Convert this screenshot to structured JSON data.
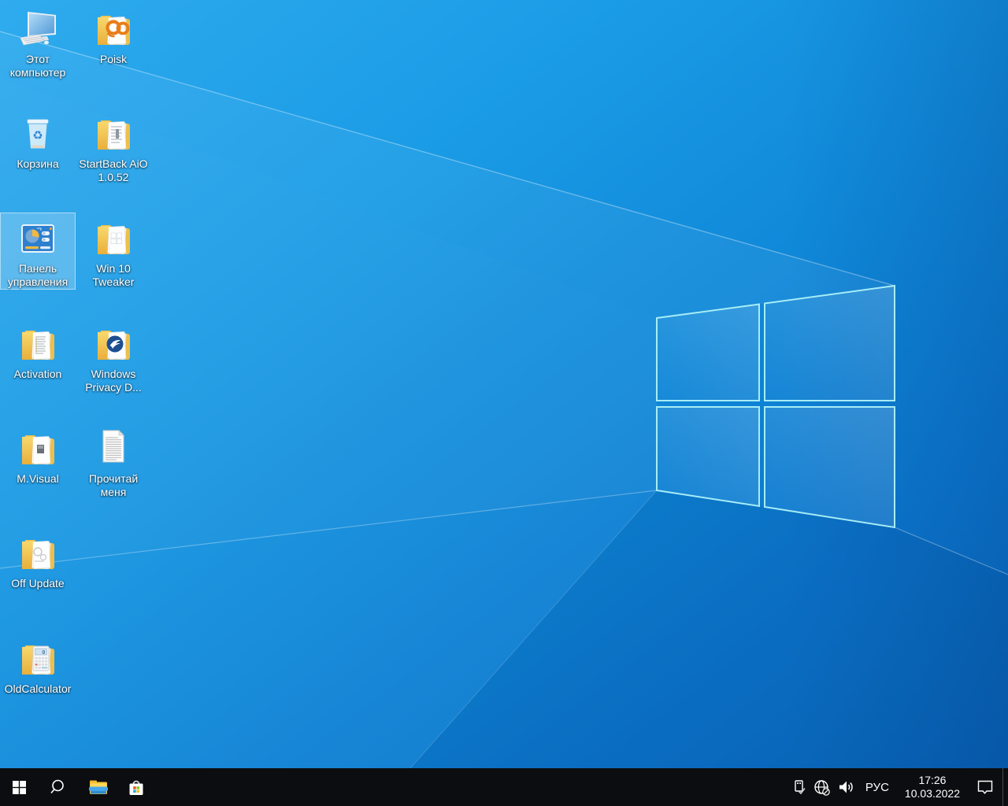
{
  "wallpaper": {
    "base_colors": [
      "#2fabee",
      "#1b9ce6",
      "#1089d9",
      "#0b74cb",
      "#0966bb"
    ],
    "logo_edge_color": "#aef2f8"
  },
  "desktop": {
    "selection_color": "rgba(140,205,244,0.5)",
    "label_color": "#ffffff",
    "icons": [
      {
        "id": "this-pc",
        "label": "Этот\nкомпьютер",
        "selected": false
      },
      {
        "id": "poisk",
        "label": "Poisk",
        "selected": false
      },
      {
        "id": "recycle-bin",
        "label": "Корзина",
        "selected": false
      },
      {
        "id": "startback",
        "label": "StartBack AiO\n1.0.52",
        "selected": false
      },
      {
        "id": "control-panel",
        "label": "Панель\nуправления",
        "selected": true
      },
      {
        "id": "win10-tweaker",
        "label": "Win 10\nTweaker",
        "selected": false
      },
      {
        "id": "activation",
        "label": "Activation",
        "selected": false
      },
      {
        "id": "windows-privacy",
        "label": "Windows\nPrivacy D...",
        "selected": false
      },
      {
        "id": "m-visual",
        "label": "M.Visual",
        "selected": false
      },
      {
        "id": "readme",
        "label": "Прочитай\nменя",
        "selected": false
      },
      {
        "id": "off-update",
        "label": "Off Update",
        "selected": false
      },
      {
        "id": "old-calculator",
        "label": "OldCalculator",
        "selected": false
      }
    ]
  },
  "taskbar": {
    "background": "#0c0d10",
    "buttons": [
      {
        "id": "start"
      },
      {
        "id": "search"
      },
      {
        "id": "file-explorer"
      },
      {
        "id": "microsoft-store"
      }
    ],
    "tray": {
      "icons": [
        {
          "id": "usb-safely-remove"
        },
        {
          "id": "network-globe-offline"
        },
        {
          "id": "volume"
        }
      ],
      "language": "РУС",
      "clock": {
        "time": "17:26",
        "date": "10.03.2022"
      }
    }
  }
}
